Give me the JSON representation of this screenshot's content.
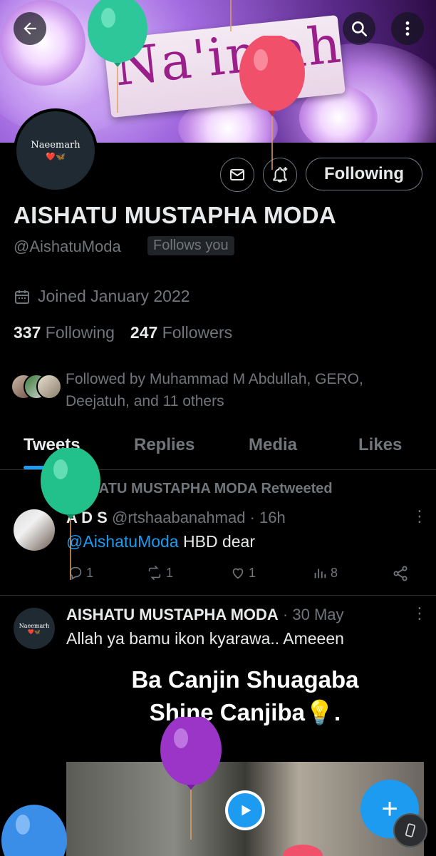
{
  "banner": {
    "sign_text": "Na'imah"
  },
  "top_bar": {
    "back_icon": "back-arrow-icon",
    "search_icon": "search-icon",
    "more_icon": "more-vertical-icon"
  },
  "profile": {
    "avatar_name": "Naeemarh",
    "avatar_emoji": "❤️🦋",
    "display_name": "AISHATU MUSTAPHA MODA",
    "handle": "@AishatuModa",
    "follows_you": "Follows you",
    "joined": "Joined January 2022",
    "following_count": "337",
    "following_label": "Following",
    "followers_count": "247",
    "followers_label": "Followers",
    "followed_by": "Followed by Muhammad M Abdullah, GERO, Deejatuh, and 11 others"
  },
  "actions": {
    "message_icon": "envelope-icon",
    "notify_icon": "bell-plus-icon",
    "follow_state": "Following"
  },
  "tabs": [
    {
      "label": "Tweets",
      "active": true
    },
    {
      "label": "Replies",
      "active": false
    },
    {
      "label": "Media",
      "active": false
    },
    {
      "label": "Likes",
      "active": false
    }
  ],
  "tweets": [
    {
      "retweet_label": "AISHATU MUSTAPHA MODA Retweeted",
      "author": "A D S",
      "handle": "@rtshaabanahmad",
      "time": "· 16h",
      "mention": "@AishatuModa",
      "text": "HBD dear",
      "replies": "1",
      "retweets": "1",
      "likes": "1",
      "views": "8"
    },
    {
      "author": "AISHATU MUSTAPHA MODA",
      "time": "· 30 May",
      "text": "Allah ya bamu ikon kyarawa.. Ameeen",
      "media_caption_line1": "Ba Canjin Shuagaba",
      "media_caption_line2": "Shine Canjiba💡.",
      "avatar_name": "Naeemarh",
      "avatar_emoji": "❤️🦋"
    }
  ],
  "fab": {
    "label": "+"
  },
  "colors": {
    "accent": "#1d9bf0",
    "background": "#000000",
    "text": "#e7e9ea",
    "muted": "#71767b"
  }
}
